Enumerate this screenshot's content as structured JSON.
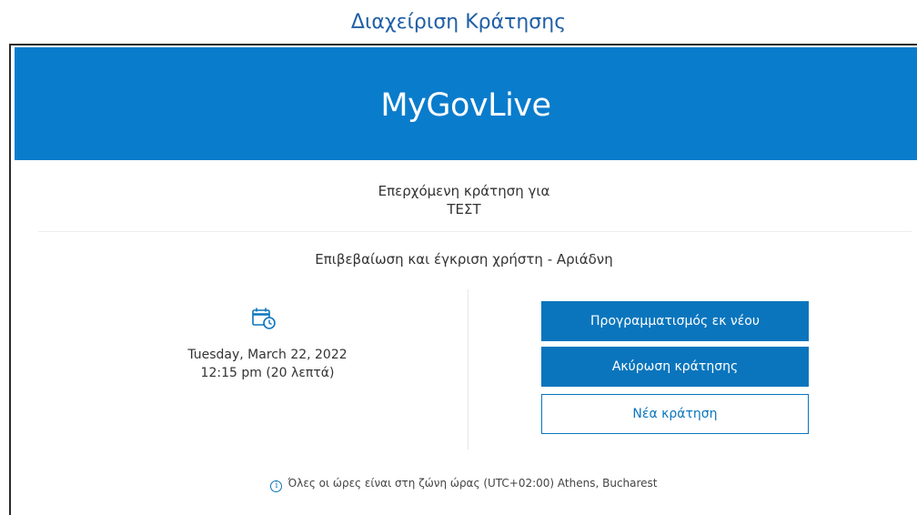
{
  "page": {
    "caption": "Διαχείριση Κράτησης"
  },
  "header": {
    "brand": "MyGovLive",
    "accent_color": "#0a7ccc"
  },
  "booking": {
    "heading_line1": "Επερχόμενη κράτηση για",
    "heading_line2": "ΤΕΣΤ",
    "service": "Επιβεβαίωση και έγκριση χρήστη - Αριάδνη",
    "date": "Tuesday, March 22, 2022",
    "time": "12:15 pm (20 λεπτά)",
    "icon": "calendar-clock-icon"
  },
  "actions": {
    "reschedule_label": "Προγραμματισμός εκ νέου",
    "cancel_label": "Ακύρωση κράτησης",
    "new_label": "Νέα κράτηση"
  },
  "footer": {
    "timezone_note": "Όλες οι ώρες είναι στη ζώνη ώρας (UTC+02:00) Athens, Bucharest",
    "info_icon": "info-icon"
  }
}
